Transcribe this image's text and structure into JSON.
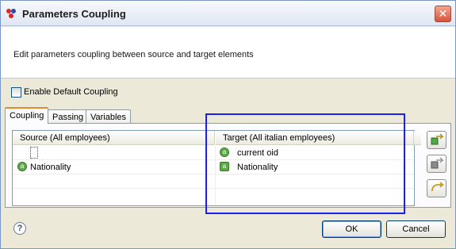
{
  "window": {
    "title": "Parameters Coupling",
    "icon": "app-logo-icon",
    "close_icon": "close-icon"
  },
  "header": {
    "description": "Edit parameters coupling between source and target elements"
  },
  "enable_default": {
    "label": "Enable Default Coupling",
    "checked": false
  },
  "tabs": [
    {
      "label": "Coupling",
      "active": true
    },
    {
      "label": "Passing",
      "active": false
    },
    {
      "label": "Variables",
      "active": false
    }
  ],
  "table": {
    "columns": [
      "Source (All employees)",
      "Target (All italian employees)"
    ],
    "rows": [
      {
        "source": "",
        "target": "current oid"
      },
      {
        "source": "Nationality",
        "target": "Nationality"
      }
    ]
  },
  "side_buttons": [
    "add-coupling-icon",
    "remove-coupling-icon",
    "auto-coupling-icon"
  ],
  "footer": {
    "ok_label": "OK",
    "cancel_label": "Cancel",
    "help_icon": "help-icon"
  },
  "colors": {
    "selection": "#1d1ef0",
    "active_tab_accent": "#e68b2c"
  }
}
